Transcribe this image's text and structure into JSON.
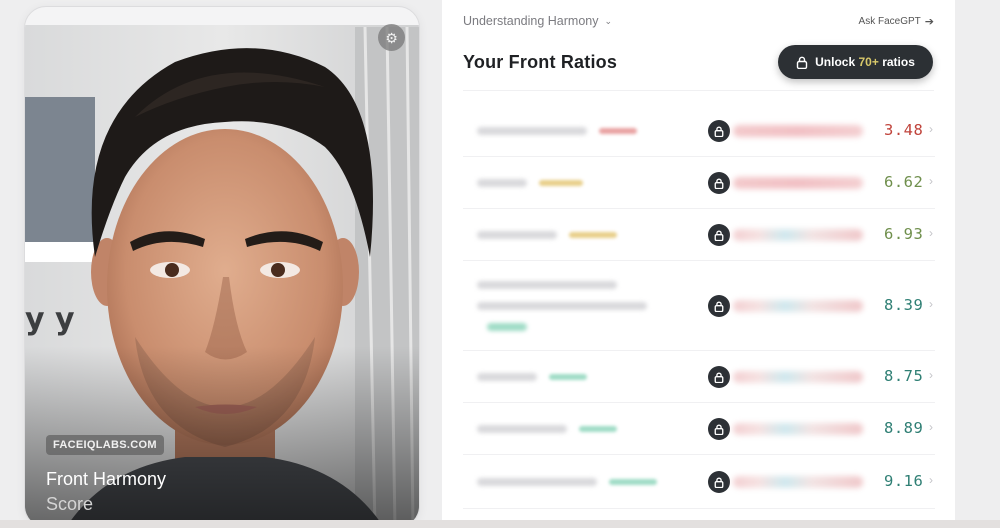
{
  "photo_card": {
    "brand": "FACEIQLABS.COM",
    "title": "Front Harmony",
    "subtitle": "Score",
    "settings_icon": "gear-icon",
    "backdrop_text": "y y"
  },
  "panel": {
    "section_label": "Understanding Harmony",
    "ask_label": "Ask FaceGPT",
    "heading": "Your Front Ratios",
    "unlock": {
      "prefix": "Unlock",
      "accent": "70+",
      "suffix": "ratios"
    }
  },
  "ratios": [
    {
      "value": "3.48",
      "tone": "red",
      "tag_color": "#e9a2a2"
    },
    {
      "value": "6.62",
      "tone": "olive",
      "tag_color": "#e8cf8a"
    },
    {
      "value": "6.93",
      "tone": "olive",
      "tag_color": "#e8cf8a"
    },
    {
      "value": "8.39",
      "tone": "teal",
      "tag_color": "#9fdcc6"
    },
    {
      "value": "8.75",
      "tone": "teal",
      "tag_color": "#9fdcc6"
    },
    {
      "value": "8.89",
      "tone": "teal",
      "tag_color": "#9fdcc6"
    },
    {
      "value": "9.16",
      "tone": "teal",
      "tag_color": "#9fdcc6"
    }
  ],
  "colors": {
    "red": "#c0443c",
    "olive": "#6f8f4c",
    "teal": "#2f7f74",
    "button_dark": "#2c3034",
    "accent_gold": "#d8c86a"
  }
}
